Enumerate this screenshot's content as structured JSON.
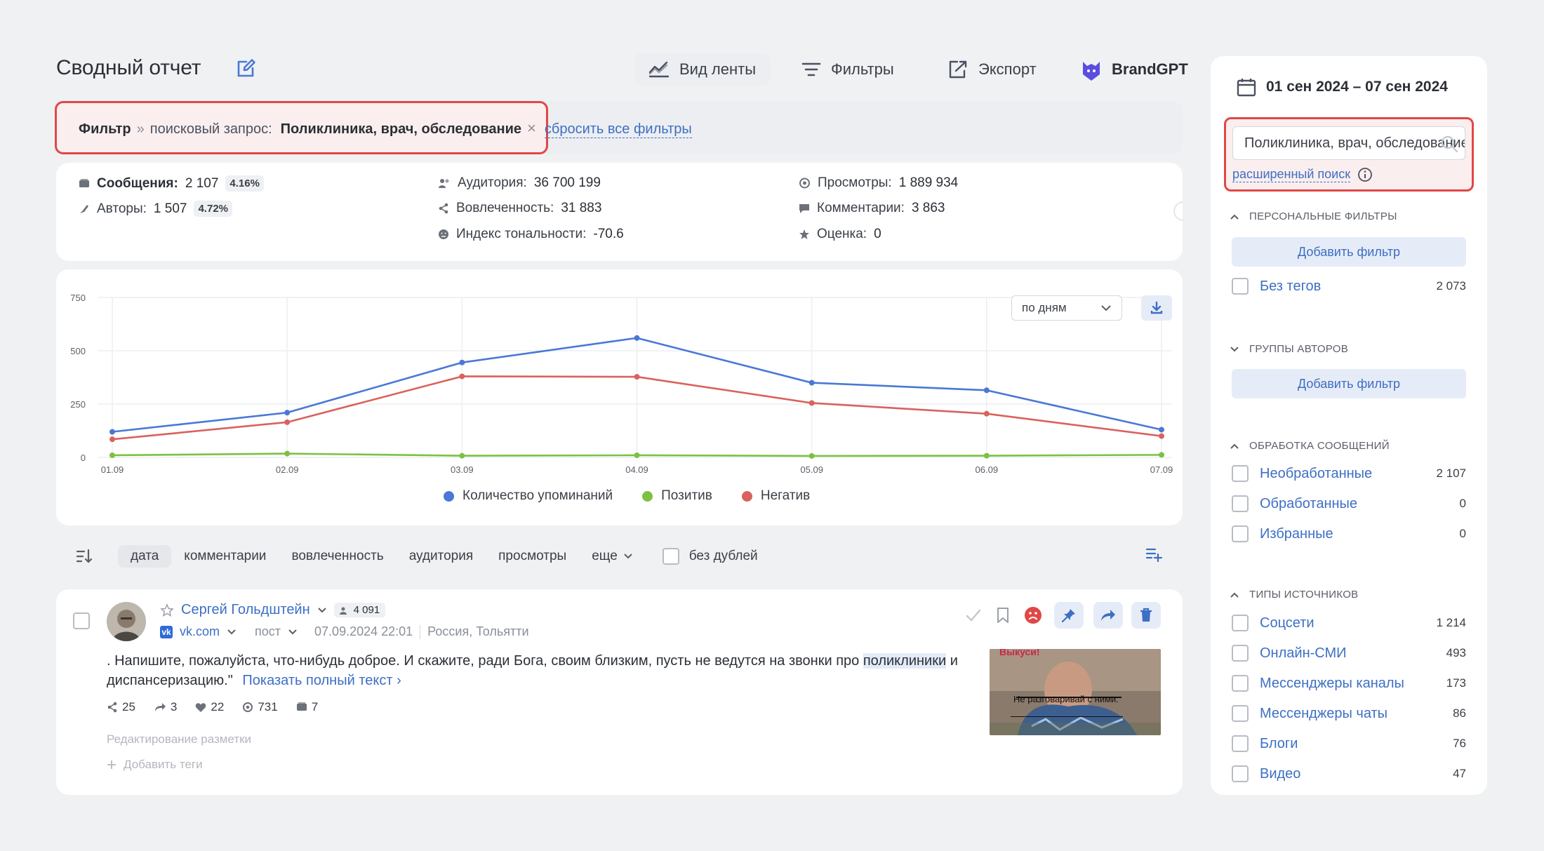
{
  "header": {
    "title": "Сводный отчет",
    "toolbar": {
      "feed_view": "Вид ленты",
      "filters": "Фильтры",
      "export": "Экспорт",
      "brandgpt": "BrandGPT"
    }
  },
  "filter_bar": {
    "label": "Фильтр",
    "separator": "»",
    "query_label": "поисковый запрос:",
    "query_value": "Поликлиника, врач, обследование",
    "remove": "×",
    "reset_all": "сбросить все фильтры"
  },
  "stats": {
    "messages_label": "Сообщения:",
    "messages_value": "2 107",
    "messages_pct": "4.16%",
    "authors_label": "Авторы:",
    "authors_value": "1 507",
    "authors_pct": "4.72%",
    "audience_label": "Аудитория:",
    "audience_value": "36 700 199",
    "engagement_label": "Вовлеченность:",
    "engagement_value": "31 883",
    "tonality_label": "Индекс тональности:",
    "tonality_value": "-70.6",
    "views_label": "Просмотры:",
    "views_value": "1 889 934",
    "comments_label": "Комментарии:",
    "comments_value": "3 863",
    "rating_label": "Оценка:",
    "rating_value": "0"
  },
  "chart_controls": {
    "period": "по дням"
  },
  "chart_data": {
    "type": "line",
    "categories": [
      "01.09",
      "02.09",
      "03.09",
      "04.09",
      "05.09",
      "06.09",
      "07.09"
    ],
    "ylim": [
      0,
      750
    ],
    "yticks": [
      0,
      250,
      500,
      750
    ],
    "grid": true,
    "legend_position": "bottom",
    "series": [
      {
        "name": "Количество упоминаний",
        "color": "#4a78d6",
        "values": [
          120,
          210,
          445,
          560,
          350,
          315,
          130
        ]
      },
      {
        "name": "Позитив",
        "color": "#7cc142",
        "values": [
          10,
          18,
          8,
          10,
          7,
          8,
          12
        ]
      },
      {
        "name": "Негатив",
        "color": "#d9625e",
        "values": [
          85,
          165,
          380,
          378,
          255,
          205,
          100
        ]
      }
    ]
  },
  "sort_bar": {
    "items": [
      "дата",
      "комментарии",
      "вовлеченность",
      "аудитория",
      "просмотры",
      "еще"
    ],
    "no_duplicates": "без дублей"
  },
  "post": {
    "author": "Сергей Гольдштейн",
    "author_reach": "4 091",
    "source": "vk.com",
    "type": "пост",
    "datetime": "07.09.2024 22:01",
    "location": "Россия, Тольятти",
    "text_before": ". Напишите, пожалуйста, что-нибудь доброе. И скажите, ради Бога, своим близким, пусть не ведутся на звонки про",
    "text_highlight": "поликлиники",
    "text_after": " и диспансеризацию.\"",
    "show_full": "Показать полный текст ›",
    "shares": "25",
    "reposts": "3",
    "likes": "22",
    "views": "731",
    "comments": "7",
    "edit_markup": "Редактирование разметки",
    "add_tags": "Добавить теги",
    "image_caption_top": "Выкуси!",
    "image_caption": "Не разговаривай с ними."
  },
  "sidebar": {
    "date_range": "01 сен 2024 – 07 сен 2024",
    "search_value": "Поликлиника, врач, обследование",
    "advanced_search": "расширенный поиск",
    "personal_filters": {
      "title": "ПЕРСОНАЛЬНЫЕ ФИЛЬТРЫ",
      "add": "Добавить фильтр",
      "items": [
        {
          "label": "Без тегов",
          "count": "2 073"
        }
      ]
    },
    "author_groups": {
      "title": "ГРУППЫ АВТОРОВ",
      "add": "Добавить фильтр"
    },
    "processing": {
      "title": "ОБРАБОТКА СООБЩЕНИЙ",
      "items": [
        {
          "label": "Необработанные",
          "count": "2 107"
        },
        {
          "label": "Обработанные",
          "count": "0"
        },
        {
          "label": "Избранные",
          "count": "0"
        }
      ]
    },
    "source_types": {
      "title": "ТИПЫ ИСТОЧНИКОВ",
      "items": [
        {
          "label": "Соцсети",
          "count": "1 214"
        },
        {
          "label": "Онлайн-СМИ",
          "count": "493"
        },
        {
          "label": "Мессенджеры каналы",
          "count": "173"
        },
        {
          "label": "Мессенджеры чаты",
          "count": "86"
        },
        {
          "label": "Блоги",
          "count": "76"
        },
        {
          "label": "Видео",
          "count": "47"
        }
      ]
    }
  }
}
